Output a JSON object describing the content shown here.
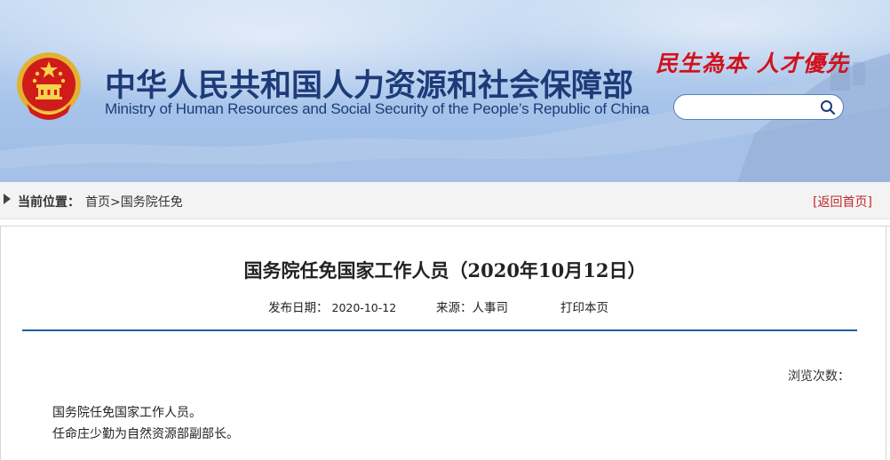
{
  "header": {
    "title_cn": "中华人民共和国人力资源和社会保障部",
    "title_en": "Ministry of Human Resources and Social Security of the People’s Republic of China",
    "slogan": "民生為本  人才優先",
    "search": {
      "value": "",
      "placeholder": ""
    },
    "icons": {
      "emblem": "national-emblem-icon",
      "search": "search-icon"
    },
    "colors": {
      "title": "#1d3b78",
      "slogan": "#d0121b"
    }
  },
  "breadcrumb": {
    "label": "当前位置：",
    "items": [
      "首页",
      ">",
      "国务院任免"
    ],
    "back_home": "[返回首页]"
  },
  "article": {
    "title": "国务院任免国家工作人员（2020年10月12日）",
    "publish_label": "发布日期：",
    "publish_date": "2020-10-12",
    "source": "来源：人事司",
    "print_label": "打印本页",
    "views_label": "浏览次数：",
    "paragraphs": [
      "国务院任免国家工作人员。",
      "任命庄少勤为自然资源部副部长。"
    ],
    "colors": {
      "divider": "#1f5aa6",
      "back_link": "#c0282d"
    }
  }
}
